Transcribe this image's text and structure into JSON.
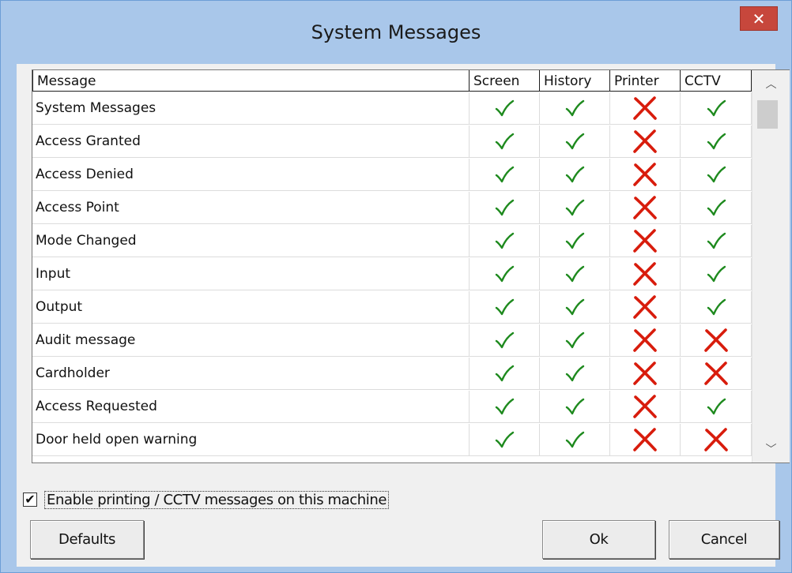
{
  "window": {
    "title": "System Messages",
    "close_symbol": "✕"
  },
  "table": {
    "columns": [
      "Message",
      "Screen",
      "History",
      "Printer",
      "CCTV"
    ],
    "rows": [
      {
        "message": "System Messages",
        "screen": true,
        "history": true,
        "printer": false,
        "cctv": true
      },
      {
        "message": "Access Granted",
        "screen": true,
        "history": true,
        "printer": false,
        "cctv": true
      },
      {
        "message": "Access Denied",
        "screen": true,
        "history": true,
        "printer": false,
        "cctv": true
      },
      {
        "message": "Access Point",
        "screen": true,
        "history": true,
        "printer": false,
        "cctv": true
      },
      {
        "message": "Mode Changed",
        "screen": true,
        "history": true,
        "printer": false,
        "cctv": true
      },
      {
        "message": "Input",
        "screen": true,
        "history": true,
        "printer": false,
        "cctv": true
      },
      {
        "message": "Output",
        "screen": true,
        "history": true,
        "printer": false,
        "cctv": true
      },
      {
        "message": "Audit message",
        "screen": true,
        "history": true,
        "printer": false,
        "cctv": false
      },
      {
        "message": "Cardholder",
        "screen": true,
        "history": true,
        "printer": false,
        "cctv": false
      },
      {
        "message": "Access Requested",
        "screen": true,
        "history": true,
        "printer": false,
        "cctv": true
      },
      {
        "message": "Door held open warning",
        "screen": true,
        "history": true,
        "printer": false,
        "cctv": false
      }
    ]
  },
  "enable_printing": {
    "checked": true,
    "label": "Enable printing / CCTV messages on this machine"
  },
  "buttons": {
    "defaults": "Defaults",
    "ok": "Ok",
    "cancel": "Cancel"
  },
  "icons": {
    "enabled": "green-check-icon",
    "disabled": "red-cross-icon"
  },
  "colors": {
    "title_bar": "#a9c7ea",
    "close_button": "#c7473c",
    "check": "#1e8a1e",
    "cross": "#d81c0c"
  }
}
